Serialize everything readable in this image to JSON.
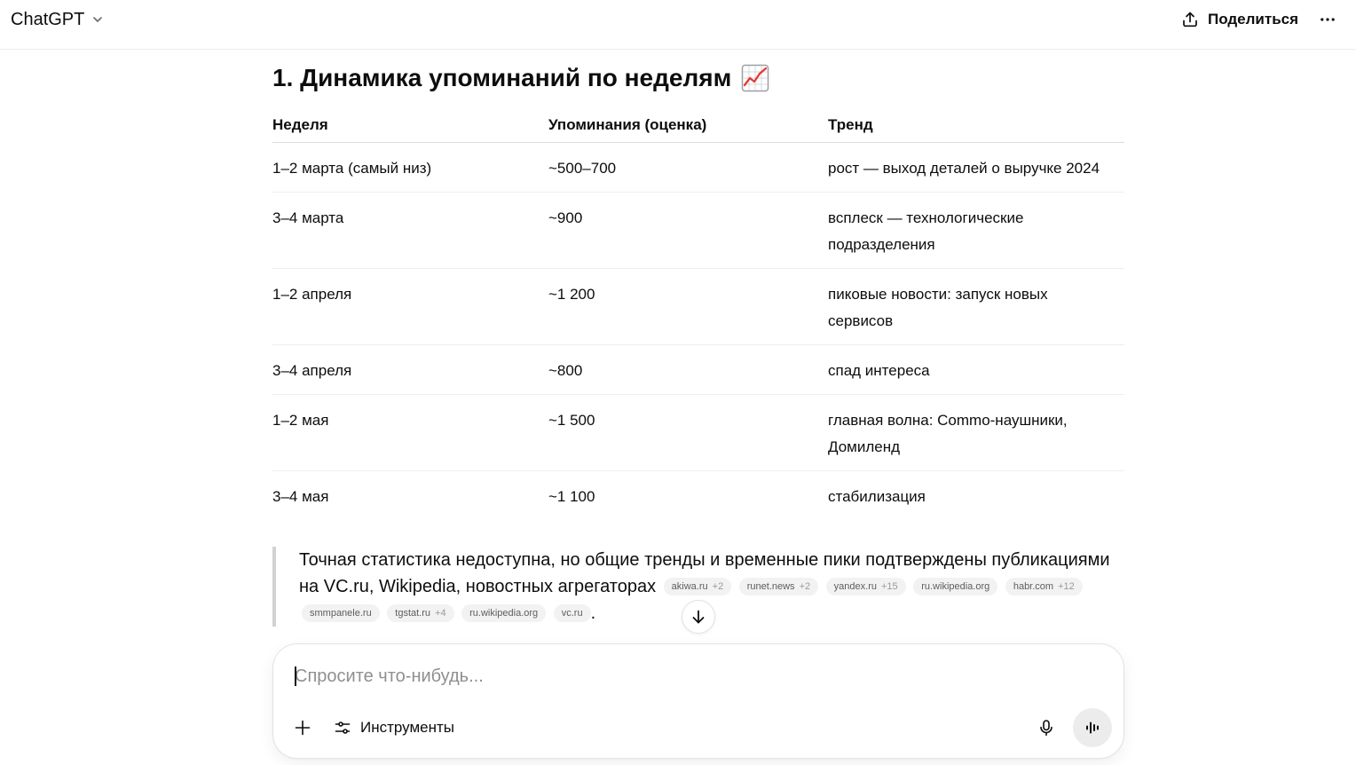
{
  "header": {
    "model_name": "ChatGPT",
    "share_label": "Поделиться"
  },
  "message": {
    "heading": "1. Динамика упоминаний по неделям",
    "heading_icon": "chart-increasing-icon",
    "table": {
      "columns": [
        "Неделя",
        "Упоминания (оценка)",
        "Тренд"
      ],
      "rows": [
        {
          "week": "1–2 марта (самый низ)",
          "mentions": "~500–700",
          "trend": "рост — выход деталей о выручке 2024"
        },
        {
          "week": "3–4 марта",
          "mentions": "~900",
          "trend": "всплеск — технологические подразделения"
        },
        {
          "week": "1–2 апреля",
          "mentions": "~1 200",
          "trend": "пиковые новости: запуск новых сервисов"
        },
        {
          "week": "3–4 апреля",
          "mentions": "~800",
          "trend": "спад интереса"
        },
        {
          "week": "1–2 мая",
          "mentions": "~1 500",
          "trend": "главная волна: Commo-наушники, Домиленд"
        },
        {
          "week": "3–4 мая",
          "mentions": "~1 100",
          "trend": "стабилизация"
        }
      ]
    },
    "quote": {
      "text": "Точная статистика недоступна, но общие тренды и временные пики подтверждены публикациями на VC.ru, Wikipedia, новостных агрегаторах",
      "citations": [
        {
          "source": "akiwa.ru",
          "extra": "+2"
        },
        {
          "source": "runet.news",
          "extra": "+2"
        },
        {
          "source": "yandex.ru",
          "extra": "+15"
        },
        {
          "source": "ru.wikipedia.org",
          "extra": ""
        },
        {
          "source": "habr.com",
          "extra": "+12"
        },
        {
          "source": "smmpanele.ru",
          "extra": ""
        },
        {
          "source": "tgstat.ru",
          "extra": "+4"
        },
        {
          "source": "ru.wikipedia.org",
          "extra": ""
        },
        {
          "source": "vc.ru",
          "extra": ""
        }
      ],
      "end_punctuation": "."
    }
  },
  "composer": {
    "placeholder": "Спросите что-нибудь...",
    "tools_label": "Инструменты"
  },
  "icons": {
    "model_menu": "chevron-down-icon",
    "share": "share-icon",
    "more": "more-dots-icon",
    "scroll_down": "arrow-down-icon",
    "attach": "plus-icon",
    "tools": "sliders-icon",
    "dictate": "microphone-icon",
    "voice": "waveform-icon"
  },
  "colors": {
    "text": "#0d0d0d",
    "placeholder": "#8f8f8f",
    "quote_border": "#d2d2d2",
    "citation_bg": "#f2f2f2",
    "voice_button_bg": "#ececec",
    "chart_emoji_line": "#e53935"
  }
}
